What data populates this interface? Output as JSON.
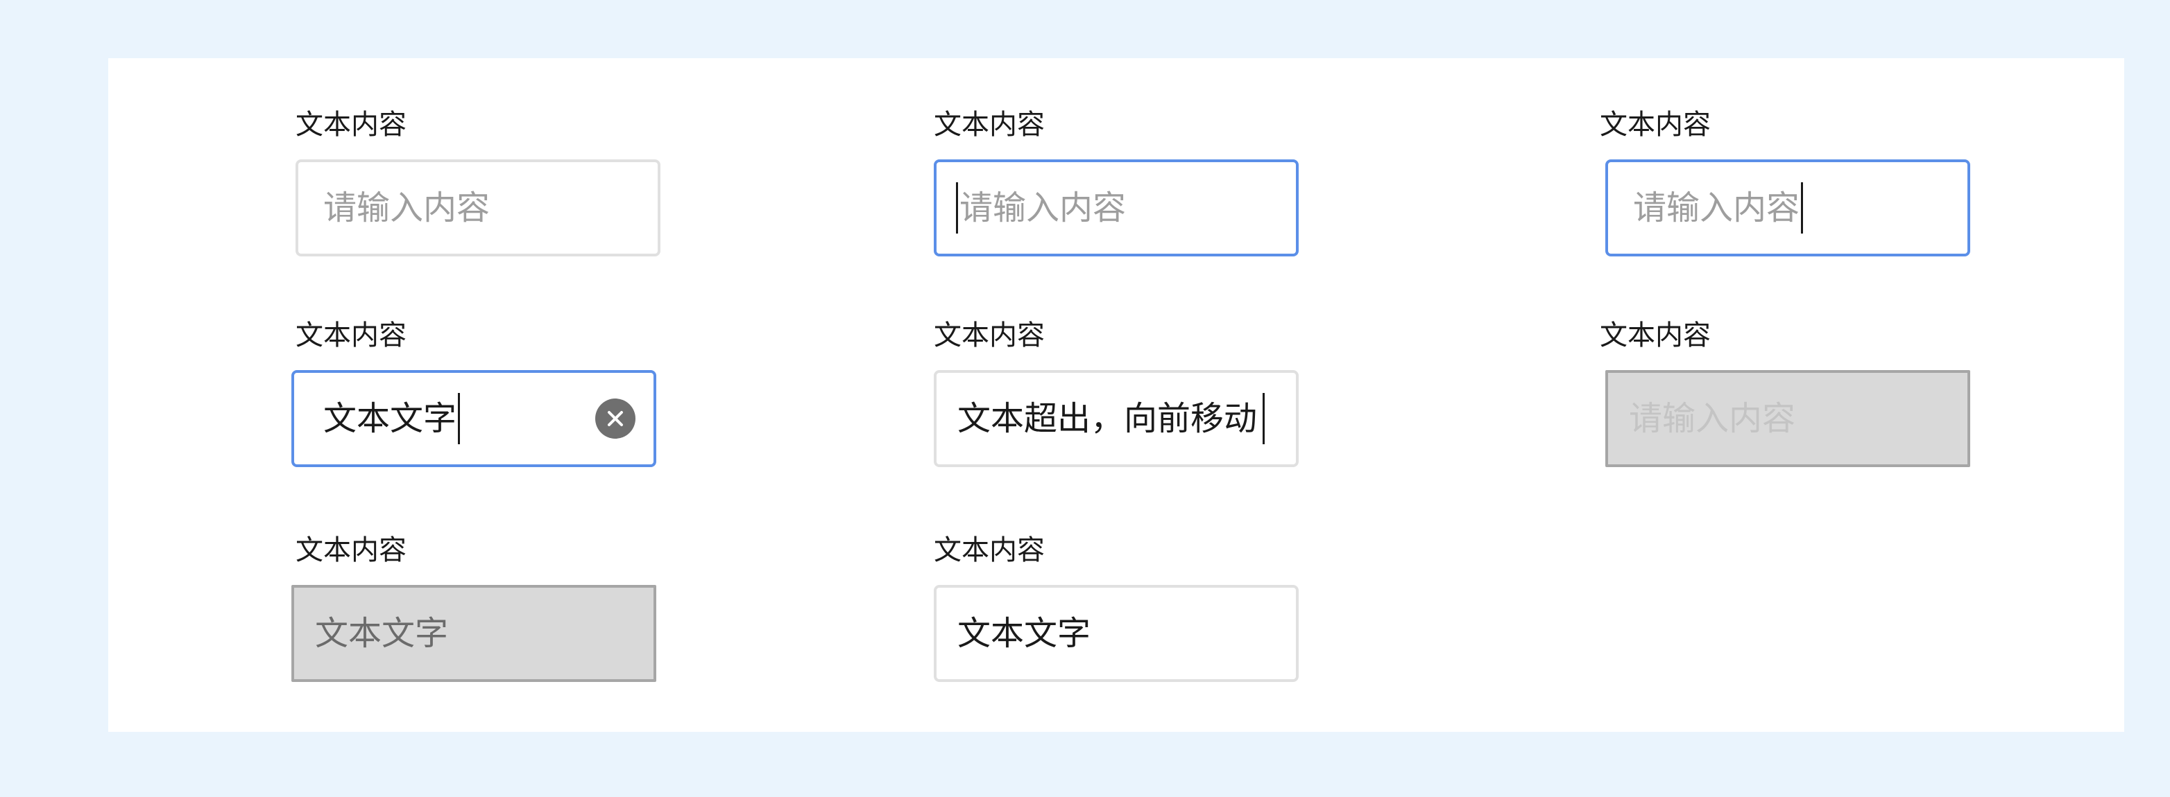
{
  "fields": [
    {
      "label": "文本内容",
      "placeholder": "请输入内容",
      "state": "default"
    },
    {
      "label": "文本内容",
      "placeholder": "请输入内容",
      "state": "focused-caret-start"
    },
    {
      "label": "文本内容",
      "placeholder": "请输入内容",
      "state": "focused-caret-end"
    },
    {
      "label": "文本内容",
      "value": "文本文字",
      "state": "focused-with-clear"
    },
    {
      "label": "文本内容",
      "value": "文本超出，向前移动",
      "state": "overflow"
    },
    {
      "label": "文本内容",
      "placeholder": "请输入内容",
      "state": "disabled-empty"
    },
    {
      "label": "文本内容",
      "value": "文本文字",
      "state": "disabled-filled"
    },
    {
      "label": "文本内容",
      "value": "文本文字",
      "state": "filled"
    }
  ],
  "icons": {
    "clear": "close-circle-icon"
  },
  "colors": {
    "page_background": "#eaf4fd",
    "focus_border": "#5b8fe8",
    "default_border": "#e0e0e0",
    "disabled_background": "#d9d9d9",
    "placeholder_text": "#9e9e9e"
  }
}
